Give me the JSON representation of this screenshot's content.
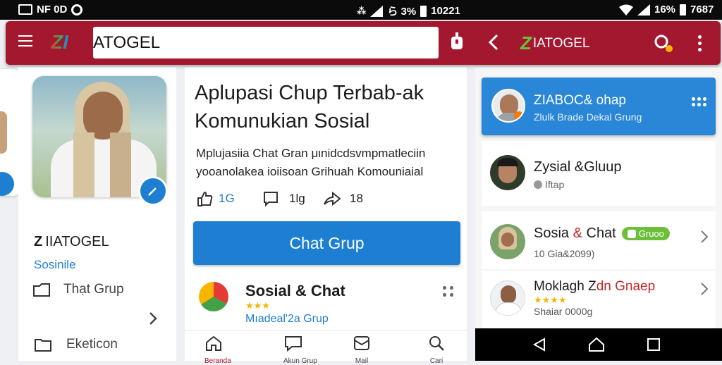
{
  "status_bar": {
    "left_text": "NF 0D",
    "center_text": "ら 3%",
    "center_time": "10221",
    "right_battery": "16%",
    "right_time": "7687"
  },
  "app_bar": {
    "logo_mark": "ZI",
    "search_value": "ATOGEL",
    "right_logo_mark": "Z",
    "right_brand": "IATOGEL"
  },
  "left_panel": {
    "brand": "IIATOGEL",
    "subtitle": "Sosinile",
    "menu_items": [
      {
        "label": "Thạt Grup"
      },
      {
        "label": "Eketicon"
      }
    ]
  },
  "post": {
    "title_line1": "Aplupasi Chup Terbab-ak",
    "title_line2": "Komunukian Sosial",
    "desc_line1": "Mplujasiia Chat Gran μιnidcdsvmpmatleciin",
    "desc_line2": "yooanolakea ioiisoan Grihuah Komouniaial",
    "likes": "1G",
    "comments": "1lg",
    "shares": "18",
    "button_label": "Chat Grup"
  },
  "feed_item": {
    "title": "Sosial & Chat",
    "stars": "★★★",
    "subtitle": "Mıadeal'2a Grup"
  },
  "bottom_tabs": [
    {
      "label": "Beranda",
      "icon": "home-icon"
    },
    {
      "label": "Akun Grup",
      "icon": "chat-icon"
    },
    {
      "label": "Mail",
      "icon": "mail-icon"
    },
    {
      "label": "Cari",
      "icon": "search-icon"
    }
  ],
  "right_panel": {
    "active_chat": {
      "title": "ZIABOC& ohap",
      "subtitle": "Zlulk Brade Dekal Grung"
    },
    "chats": [
      {
        "title": "Zysial &Gluup",
        "subtitle": "Iftap"
      },
      {
        "title_a": "Sosia ",
        "title_amp": "&",
        "title_b": " Chat",
        "badge": "Gruoo",
        "subtitle": "10 Gia&2099)"
      },
      {
        "title_a": "Moklagh Z",
        "title_b": "dn Gnaep",
        "stars": "★★★★",
        "subtitle": "Shaiar 0000g"
      }
    ]
  },
  "colors": {
    "brand_red": "#a3182f",
    "accent_blue": "#1e7fd2",
    "badge_green": "#6cbf3a"
  }
}
